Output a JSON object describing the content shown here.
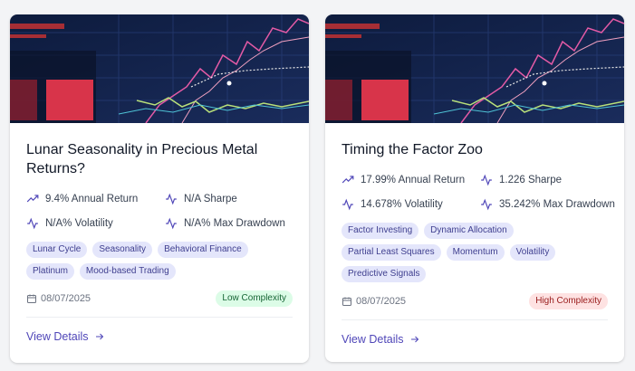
{
  "cards": [
    {
      "title": "Lunar Seasonality in Precious Metal Returns?",
      "metrics": {
        "annual_return": "9.4% Annual Return",
        "sharpe": "N/A Sharpe",
        "volatility": "N/A% Volatility",
        "max_drawdown": "N/A% Max Drawdown"
      },
      "tags": [
        "Lunar Cycle",
        "Seasonality",
        "Behavioral Finance",
        "Platinum",
        "Mood-based Trading"
      ],
      "date": "08/07/2025",
      "complexity": "Low Complexity",
      "view_details": "View Details"
    },
    {
      "title": "Timing the Factor Zoo",
      "metrics": {
        "annual_return": "17.99% Annual Return",
        "sharpe": "1.226 Sharpe",
        "volatility": "14.678% Volatility",
        "max_drawdown": "35.242% Max Drawdown"
      },
      "tags": [
        "Factor Investing",
        "Dynamic Allocation",
        "Partial Least Squares",
        "Momentum",
        "Volatility",
        "Predictive Signals"
      ],
      "date": "08/07/2025",
      "complexity": "High Complexity",
      "view_details": "View Details"
    }
  ],
  "icons": {
    "trend": "trending-up-icon",
    "activity": "activity-icon",
    "calendar": "calendar-icon",
    "arrow": "arrow-right-icon"
  },
  "colors": {
    "accent": "#4f46b8",
    "tag_bg": "#e4e6fb",
    "low_bg": "#dcfce7",
    "high_bg": "#fee2e2"
  }
}
